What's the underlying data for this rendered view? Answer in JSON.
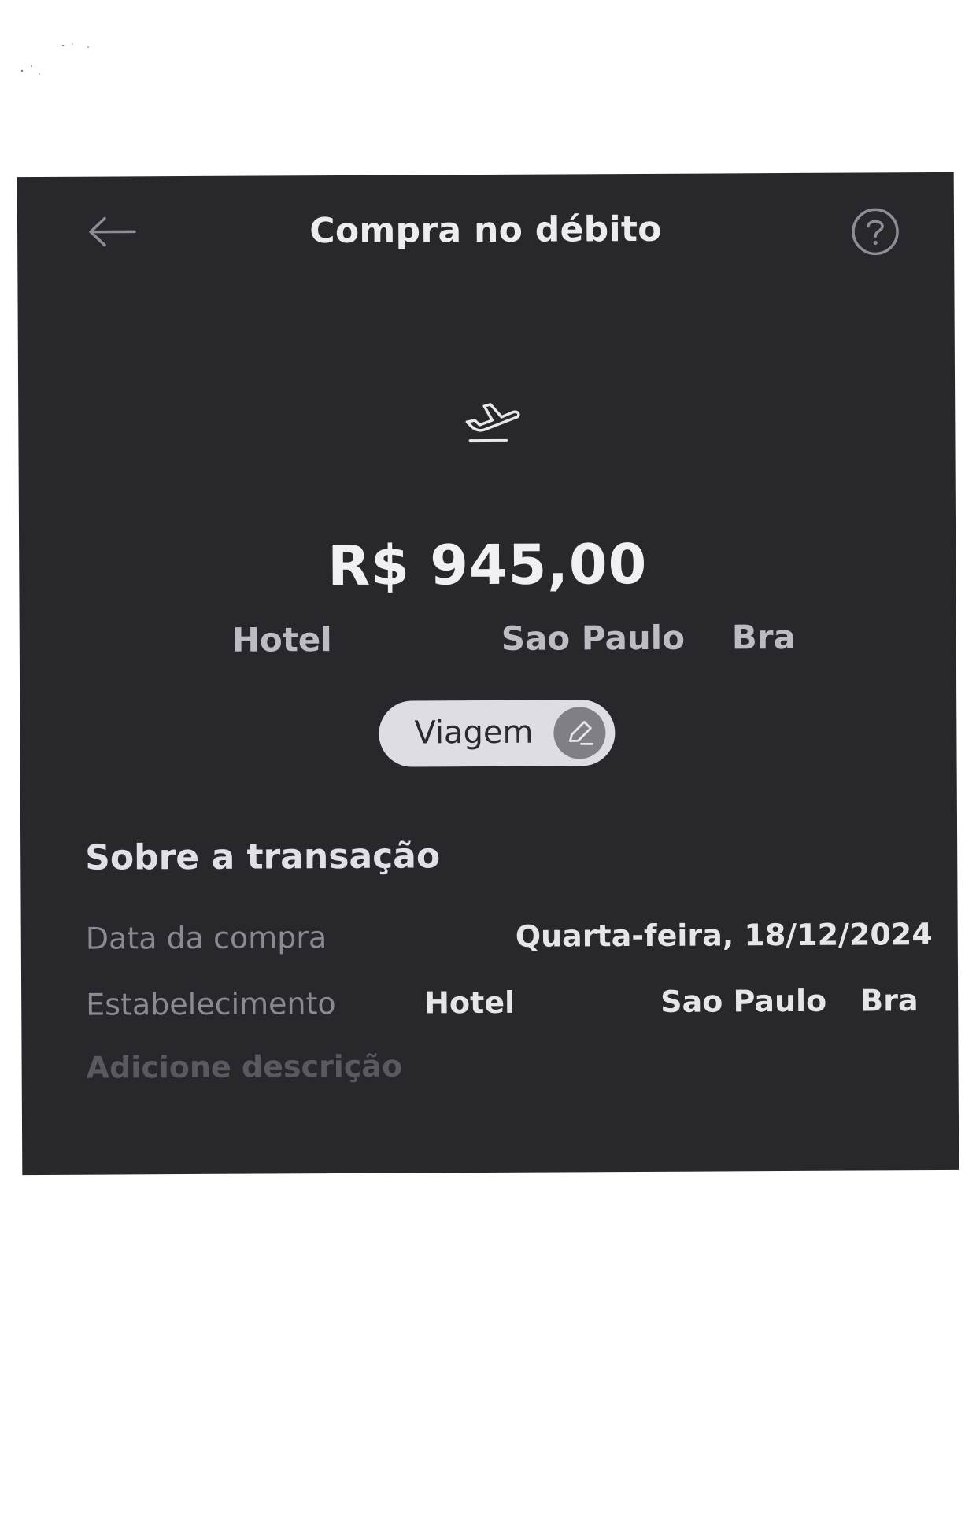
{
  "header": {
    "title": "Compra no débito",
    "back_icon": "arrow-left-icon",
    "help_icon": "question-circle-icon"
  },
  "transaction": {
    "category_icon": "airplane-takeoff-icon",
    "amount": "R$ 945,00",
    "merchant_name": "Hotel",
    "merchant_city": "Sao Paulo",
    "merchant_country": "Bra",
    "category_chip": {
      "label": "Viagem",
      "edit_icon": "pencil-icon"
    }
  },
  "details": {
    "section_title": "Sobre a transação",
    "rows": [
      {
        "label": "Data da compra",
        "value": "Quarta-feira, 18/12/2024"
      },
      {
        "label": "Estabelecimento",
        "value_name": "Hotel",
        "value_city": "Sao Paulo",
        "value_country": "Bra"
      }
    ],
    "add_description_label": "Adicione descrição"
  },
  "colors": {
    "background": "#28272b",
    "text_primary": "#ececf0",
    "text_secondary": "#8b8a90",
    "chip_background": "#dfdde4",
    "chip_icon_background": "#807f85",
    "paper": "#ffffff"
  }
}
